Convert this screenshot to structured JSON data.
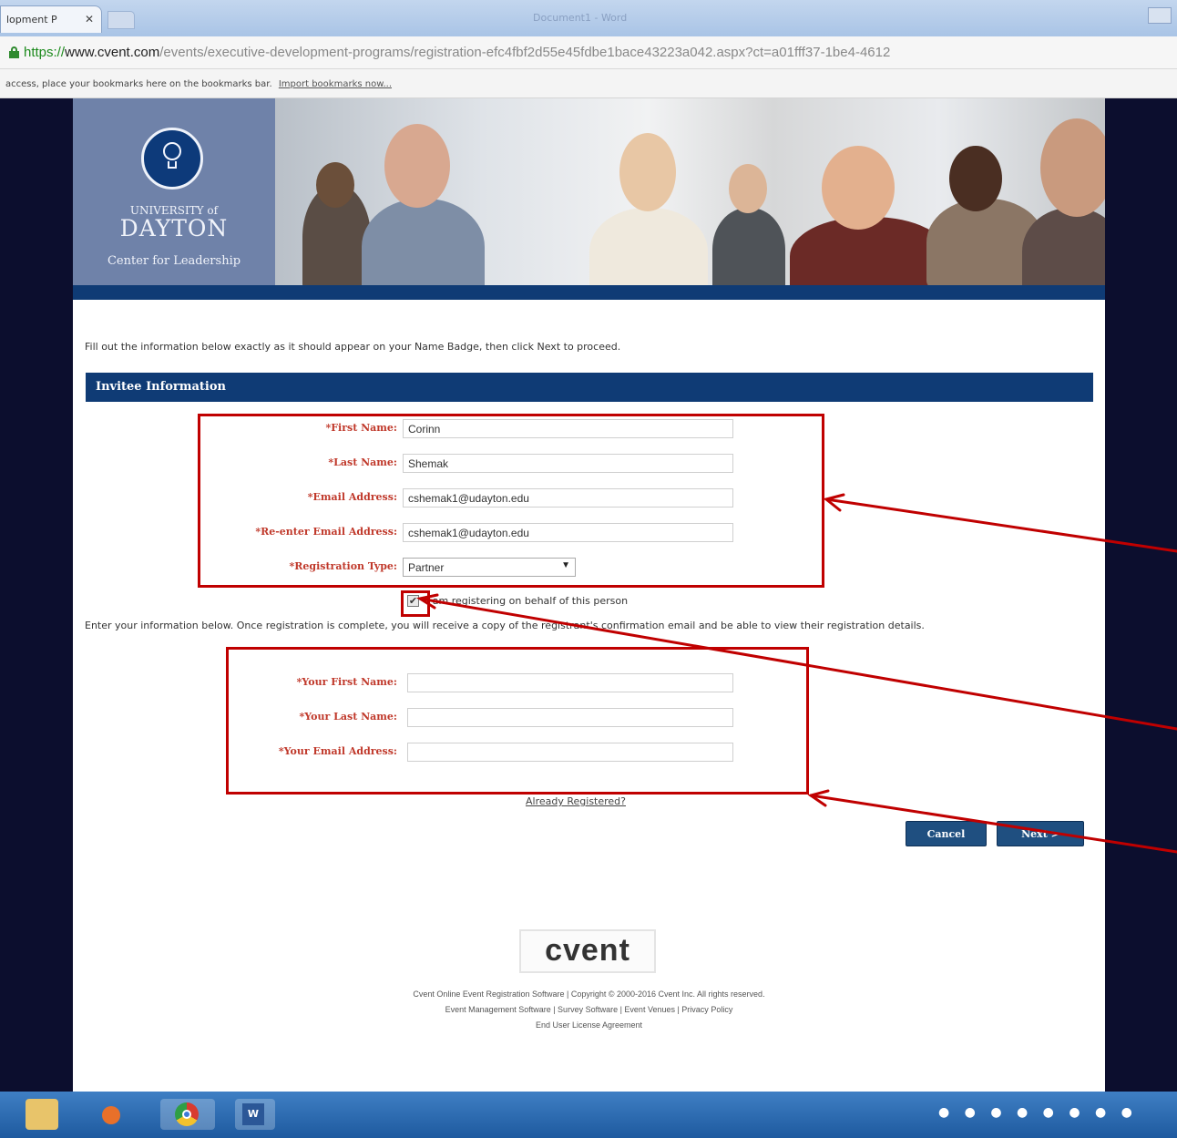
{
  "browser": {
    "tab_title": "lopment P",
    "tab_close": "✕",
    "window_title": "Document1 - Word",
    "url_scheme": "https://",
    "url_host": "www.cvent.com",
    "url_path": "/events/executive-development-programs/registration-efc4fbf2d55e45fdbe1bace43223a042.aspx?ct=a01fff37-1be4-4612",
    "bookmarks_text": "access, place your bookmarks here on the bookmarks bar.",
    "bookmarks_link": "Import bookmarks now..."
  },
  "branding": {
    "line1": "UNIVERSITY of",
    "line2": "DAYTON",
    "line3": "Center for Leadership"
  },
  "form": {
    "intro": "Fill out the information below exactly as it should appear on your Name Badge, then click Next to proceed.",
    "section_title": "Invitee Information",
    "fields": [
      {
        "label": "*First Name:",
        "value": "Corinn"
      },
      {
        "label": "*Last Name:",
        "value": "Shemak"
      },
      {
        "label": "*Email Address:",
        "value": "cshemak1@udayton.edu"
      },
      {
        "label": "*Re-enter Email Address:",
        "value": "cshemak1@udayton.edu"
      }
    ],
    "registration_type": {
      "label": "*Registration Type:",
      "value": "Partner"
    },
    "behalf_checkbox": {
      "checked": true,
      "label": "I am registering on behalf of this person"
    },
    "behalf_note": "Enter your information below. Once registration is complete, you will receive a copy of the registrant's confirmation email and be able to view their registration details.",
    "your_fields": [
      {
        "label": "*Your First Name:",
        "value": ""
      },
      {
        "label": "*Your Last Name:",
        "value": ""
      },
      {
        "label": "*Your Email Address:",
        "value": ""
      }
    ],
    "already_registered": "Already Registered?",
    "cancel_label": "Cancel",
    "next_label": "Next >"
  },
  "footer": {
    "logo_text": "cvent",
    "line1": "Cvent Online Event Registration Software | Copyright © 2000-2016 Cvent Inc. All rights reserved.",
    "line2": "Event Management Software | Survey Software | Event Venues | Privacy Policy",
    "line3": "End User License Agreement"
  },
  "colors": {
    "brand_navy": "#0f3b75",
    "required_label": "#c0392b",
    "annotation_red": "#c00000"
  },
  "taskbar": {
    "icons": [
      "file-explorer-icon",
      "media-player-icon",
      "chrome-icon",
      "word-icon"
    ]
  }
}
